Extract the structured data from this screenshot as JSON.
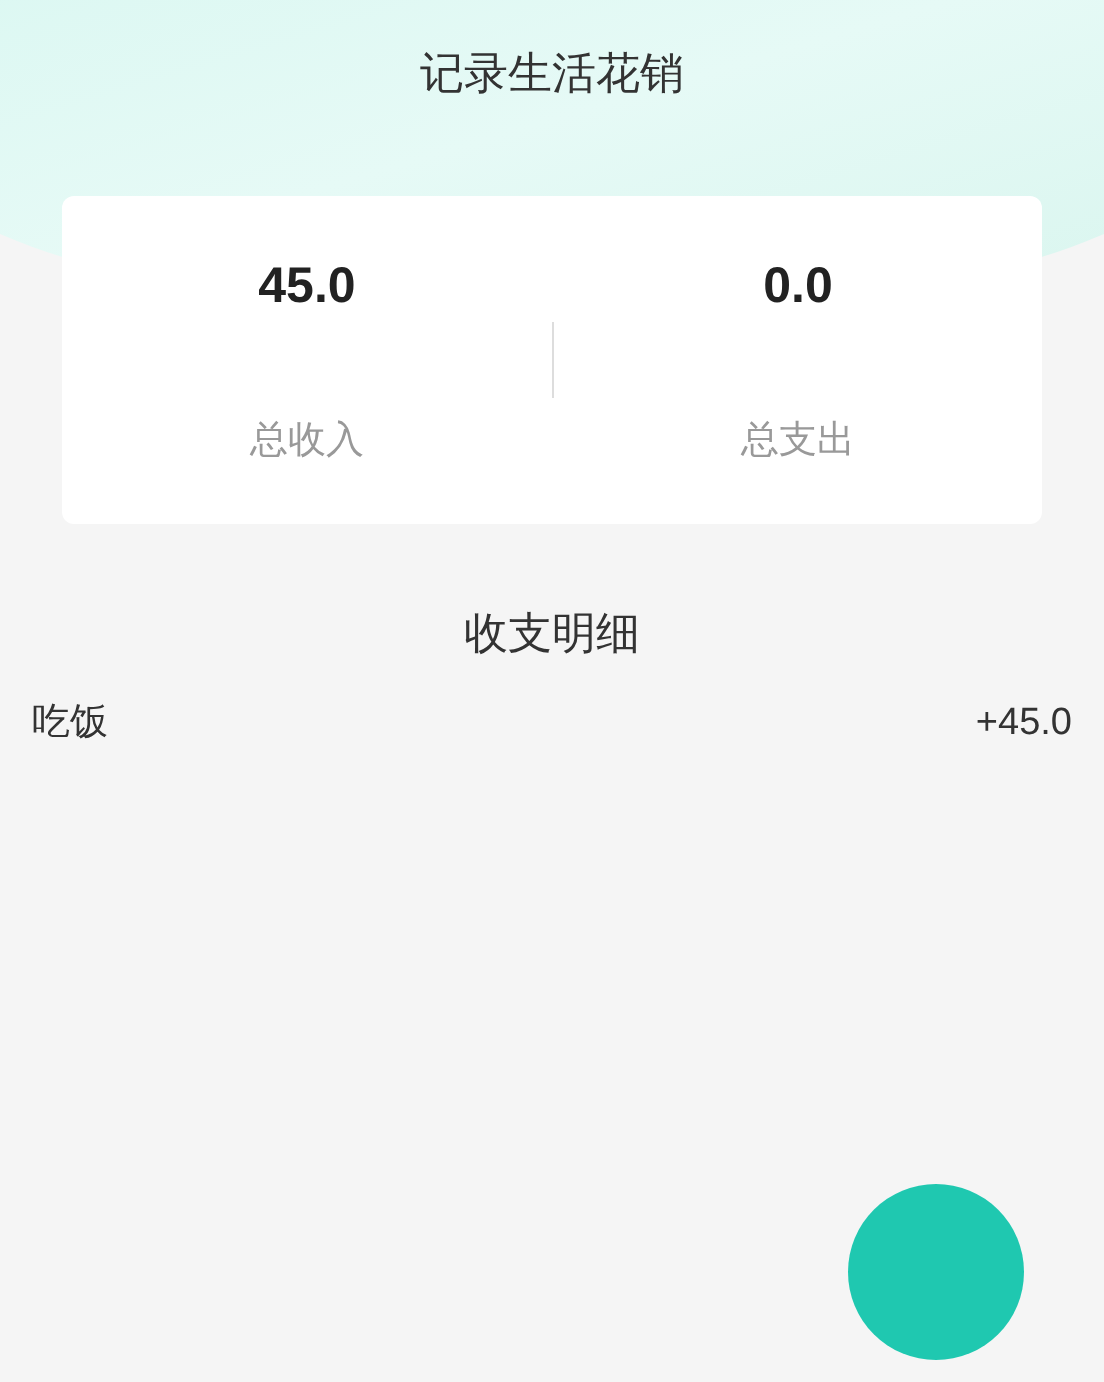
{
  "header": {
    "title": "记录生活花销"
  },
  "summary": [
    {
      "value": "45.0",
      "label": "总收入"
    },
    {
      "value": "0.0",
      "label": "总支出"
    }
  ],
  "details": {
    "title": "收支明细",
    "rows": [
      {
        "name": "吃饭",
        "amount": "+45.0"
      }
    ]
  }
}
